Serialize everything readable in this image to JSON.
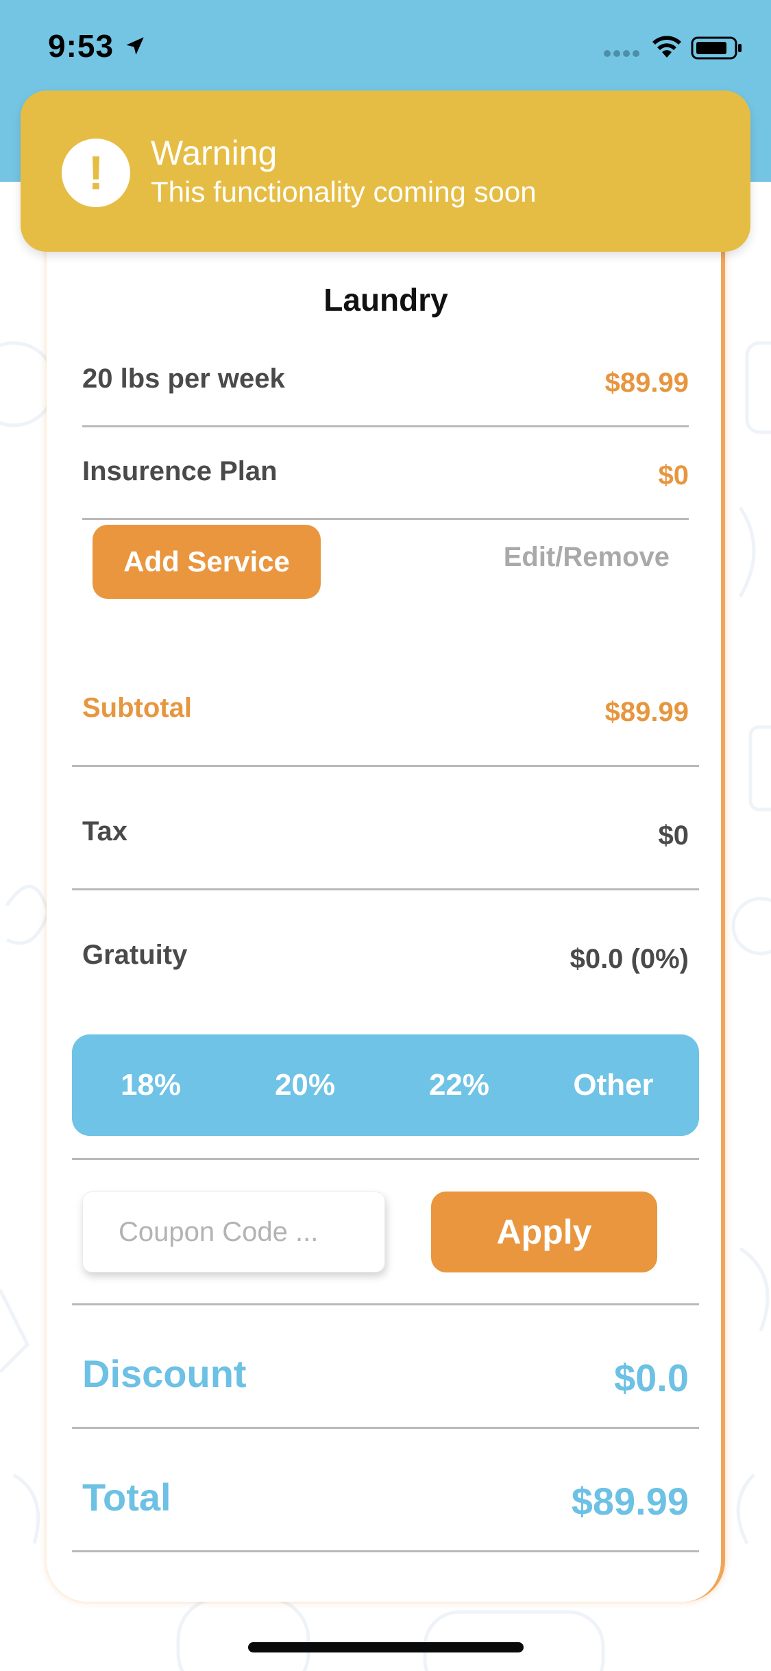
{
  "status_bar": {
    "time": "9:53"
  },
  "warning": {
    "title": "Warning",
    "message": "This functionality coming soon",
    "icon": "!"
  },
  "card": {
    "title": "Laundry",
    "services": [
      {
        "label": "20 lbs per week",
        "price": "$89.99"
      },
      {
        "label": "Insurence Plan",
        "price": "$0"
      }
    ],
    "add_service_label": "Add Service",
    "edit_remove_label": "Edit/Remove",
    "subtotal": {
      "label": "Subtotal",
      "value": "$89.99"
    },
    "tax": {
      "label": "Tax",
      "value": "$0"
    },
    "gratuity": {
      "label": "Gratuity",
      "value": "$0.0 (0%)"
    },
    "tip_options": [
      "18%",
      "20%",
      "22%",
      "Other"
    ],
    "coupon": {
      "placeholder": "Coupon Code ...",
      "value": ""
    },
    "apply_label": "Apply",
    "discount": {
      "label": "Discount",
      "value": "$0.0"
    },
    "total": {
      "label": "Total",
      "value": "$89.99"
    }
  },
  "colors": {
    "header_blue": "#74c5e4",
    "warning_yellow": "#e6bd44",
    "accent_orange": "#e9963e",
    "accent_blue": "#6ec3e6"
  }
}
